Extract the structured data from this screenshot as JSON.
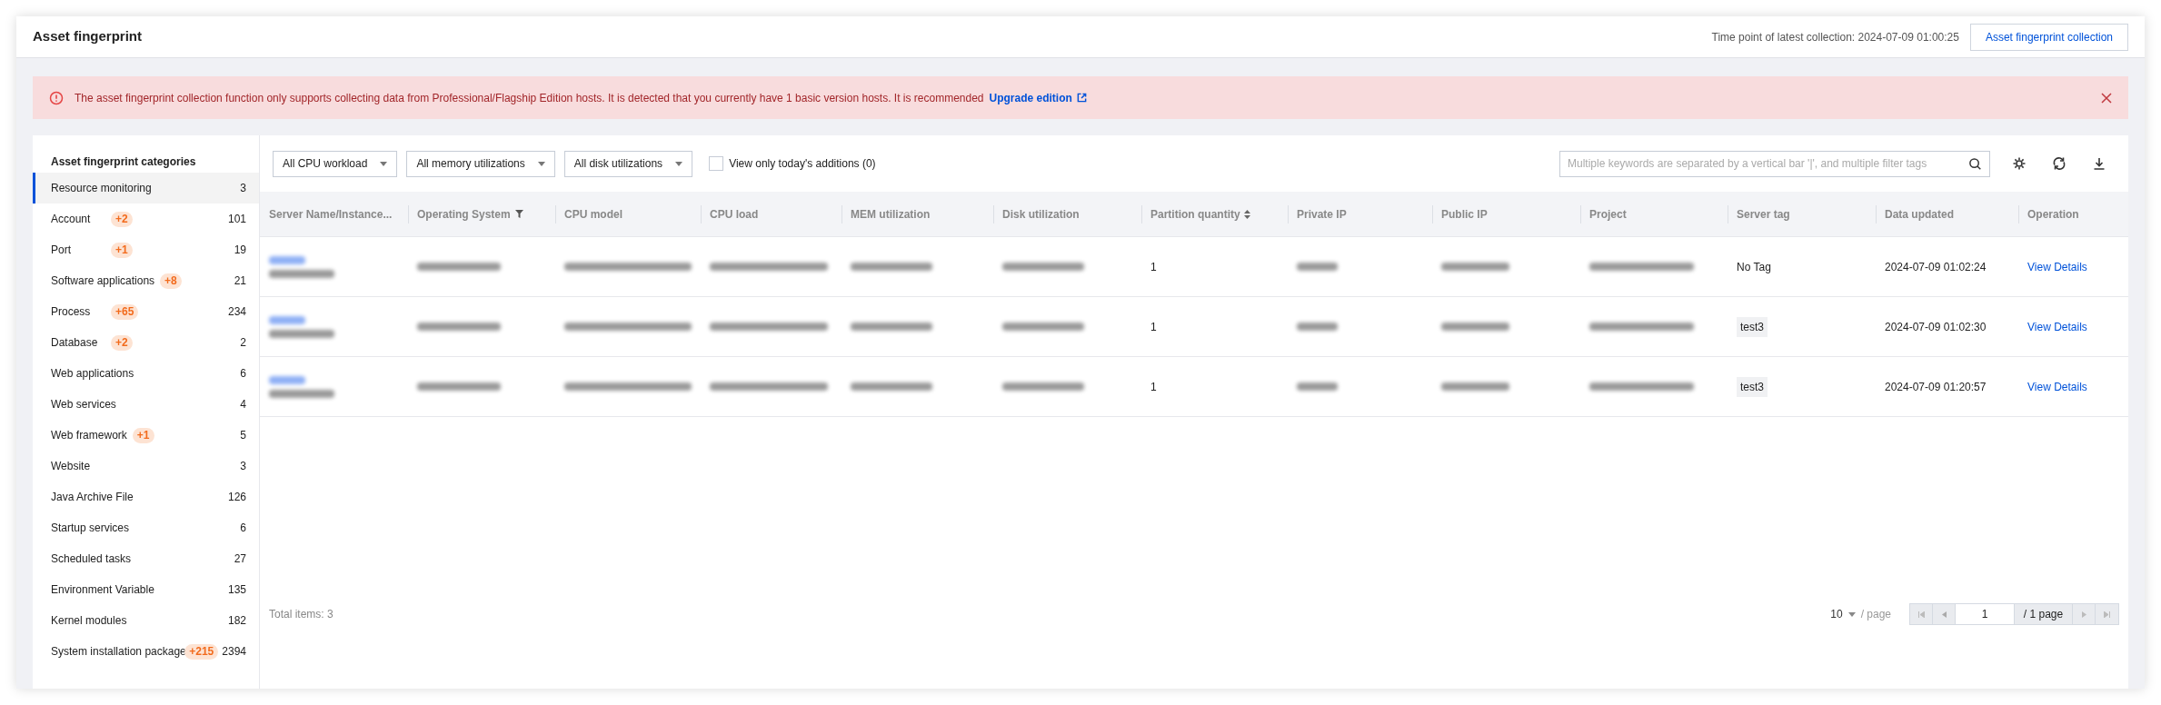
{
  "header": {
    "title": "Asset fingerprint",
    "last_collection": "Time point of latest collection: 2024-07-09 01:00:25",
    "button": "Asset fingerprint collection"
  },
  "alert": {
    "message": "The asset fingerprint collection function only supports collecting data from Professional/Flagship Edition hosts. It is detected that you currently have 1 basic version hosts. It is recommended",
    "link": "Upgrade edition"
  },
  "sidebar": {
    "title": "Asset fingerprint categories",
    "items": [
      {
        "label": "Resource monitoring",
        "count": "3",
        "selected": true
      },
      {
        "label": "Account",
        "badge": "+2",
        "count": "101",
        "selected": false
      },
      {
        "label": "Port",
        "badge": "+1",
        "count": "19",
        "selected": false
      },
      {
        "label": "Software applications",
        "badge": "+8",
        "count": "21",
        "selected": false
      },
      {
        "label": "Process",
        "badge": "+65",
        "count": "234",
        "selected": false
      },
      {
        "label": "Database",
        "badge": "+2",
        "count": "2",
        "selected": false
      },
      {
        "label": "Web applications",
        "count": "6",
        "selected": false
      },
      {
        "label": "Web services",
        "count": "4",
        "selected": false
      },
      {
        "label": "Web framework",
        "badge": "+1",
        "count": "5",
        "selected": false
      },
      {
        "label": "Website",
        "count": "3",
        "selected": false
      },
      {
        "label": "Java Archive File",
        "count": "126",
        "selected": false
      },
      {
        "label": "Startup services",
        "count": "6",
        "selected": false
      },
      {
        "label": "Scheduled tasks",
        "count": "27",
        "selected": false
      },
      {
        "label": "Environment Variable",
        "count": "135",
        "selected": false
      },
      {
        "label": "Kernel modules",
        "count": "182",
        "selected": false
      },
      {
        "label": "System installation package",
        "badge": "+215",
        "count": "2394",
        "selected": false
      }
    ]
  },
  "filters": [
    {
      "label": "All CPU workload"
    },
    {
      "label": "All memory utilizations"
    },
    {
      "label": "All disk utilizations"
    }
  ],
  "today_checkbox": {
    "label": "View only today's additions (0)",
    "checked": false
  },
  "search": {
    "placeholder": "Multiple keywords are separated by a vertical bar '|', and multiple filter tags"
  },
  "table": {
    "columns": [
      {
        "label": "Server Name/Instance..."
      },
      {
        "label": "Operating System",
        "kind": "filter"
      },
      {
        "label": "CPU model"
      },
      {
        "label": "CPU load"
      },
      {
        "label": "MEM utilization"
      },
      {
        "label": "Disk utilization"
      },
      {
        "label": "Partition quantity",
        "kind": "sort"
      },
      {
        "label": "Private IP"
      },
      {
        "label": "Public IP"
      },
      {
        "label": "Project"
      },
      {
        "label": "Server tag"
      },
      {
        "label": "Data updated"
      },
      {
        "label": "Operation"
      }
    ],
    "rows": [
      {
        "cells": [
          {
            "kind": "redacted_name"
          },
          {
            "kind": "redacted"
          },
          {
            "kind": "redacted"
          },
          {
            "kind": "redacted"
          },
          {
            "kind": "redacted"
          },
          {
            "kind": "redacted"
          },
          {
            "kind": "text",
            "text": "1"
          },
          {
            "kind": "redacted"
          },
          {
            "kind": "redacted"
          },
          {
            "kind": "redacted"
          },
          {
            "kind": "text",
            "text": "No Tag"
          },
          {
            "kind": "text",
            "text": "2024-07-09 01:02:24"
          },
          {
            "kind": "link",
            "text": "View Details"
          }
        ]
      },
      {
        "cells": [
          {
            "kind": "redacted_name"
          },
          {
            "kind": "redacted"
          },
          {
            "kind": "redacted"
          },
          {
            "kind": "redacted"
          },
          {
            "kind": "redacted"
          },
          {
            "kind": "redacted"
          },
          {
            "kind": "text",
            "text": "1"
          },
          {
            "kind": "redacted"
          },
          {
            "kind": "redacted"
          },
          {
            "kind": "redacted"
          },
          {
            "kind": "tag",
            "text": "test3"
          },
          {
            "kind": "text",
            "text": "2024-07-09 01:02:30"
          },
          {
            "kind": "link",
            "text": "View Details"
          }
        ]
      },
      {
        "cells": [
          {
            "kind": "redacted_name"
          },
          {
            "kind": "redacted"
          },
          {
            "kind": "redacted"
          },
          {
            "kind": "redacted"
          },
          {
            "kind": "redacted"
          },
          {
            "kind": "redacted"
          },
          {
            "kind": "text",
            "text": "1"
          },
          {
            "kind": "redacted"
          },
          {
            "kind": "redacted"
          },
          {
            "kind": "redacted"
          },
          {
            "kind": "tag",
            "text": "test3"
          },
          {
            "kind": "text",
            "text": "2024-07-09 01:20:57"
          },
          {
            "kind": "link",
            "text": "View Details"
          }
        ]
      }
    ]
  },
  "footer": {
    "total": "Total items: 3",
    "page_size": "10",
    "page_size_unit": "/ page",
    "page": "1",
    "page_count": "/ 1 page"
  }
}
